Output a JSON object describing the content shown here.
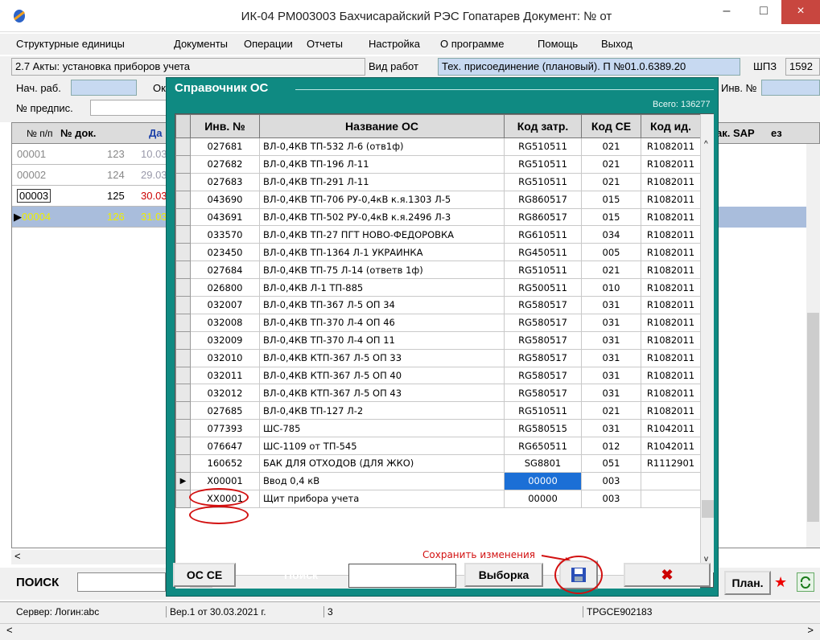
{
  "window": {
    "title": "ИК-04 РМ003003 Бахчисарайский РЭС Гопатарев Документ: № от",
    "minimize": "–",
    "maximize": "□",
    "close": "×"
  },
  "menu": [
    "Структурные единицы",
    "Документы",
    "Операции",
    "Отчеты",
    "Настройка",
    "О программе",
    "Помощь",
    "Выход"
  ],
  "info": {
    "act": "2.7  Акты: установка приборов учета",
    "work_label": "Вид работ",
    "work_value": "Тех. присоединение (плановый). П №01.0.6389.20",
    "shpz_label": "ШПЗ",
    "shpz_value": "1592"
  },
  "filters": {
    "start_label": "Нач. раб.",
    "ok_label": "Ок",
    "inv_label": "Инв. №",
    "prescr_label": "№ предпис."
  },
  "left_grid": {
    "headers": [
      "№ п/п",
      "№ док.",
      "Да"
    ],
    "rows": [
      {
        "n": "00001",
        "doc": "123",
        "date": "10.03"
      },
      {
        "n": "00002",
        "doc": "124",
        "date": "29.03"
      },
      {
        "n": "00003",
        "doc": "125",
        "date": "30.03"
      },
      {
        "n": "00004",
        "doc": "126",
        "date": "31.03"
      }
    ]
  },
  "right_grid": {
    "headers": [
      "ак. SAP",
      "ез"
    ]
  },
  "bottom": {
    "search_label": "ПОИСК",
    "plan_button": "План."
  },
  "status": {
    "server": "Сервер:  Логин:abc",
    "version": "Вер.1 от 30.03.2021 г.",
    "num": "3",
    "code": "TPGCE902183"
  },
  "dialog": {
    "title": "Справочник ОС",
    "total": "Всего: 136277",
    "headers": [
      "Инв. №",
      "Название ОС",
      "Код затр.",
      "Код СЕ",
      "Код ид."
    ],
    "rows": [
      [
        "027681",
        "ВЛ-0,4КВ ТП-532 Л-6 (отв1ф)",
        "RG510511",
        "021",
        "R1082011"
      ],
      [
        "027682",
        "ВЛ-0,4КВ ТП-196 Л-11",
        "RG510511",
        "021",
        "R1082011"
      ],
      [
        "027683",
        "ВЛ-0,4КВ ТП-291 Л-11",
        "RG510511",
        "021",
        "R1082011"
      ],
      [
        "043690",
        "ВЛ-0,4КВ ТП-706 РУ-0,4кВ к.я.1303 Л-5",
        "RG860517",
        "015",
        "R1082011"
      ],
      [
        "043691",
        "ВЛ-0,4КВ ТП-502 РУ-0,4кВ к.я.2496 Л-3",
        "RG860517",
        "015",
        "R1082011"
      ],
      [
        "033570",
        "ВЛ-0,4КВ ТП-27 ПГТ НОВО-ФЕДОРОВКА",
        "RG610511",
        "034",
        "R1082011"
      ],
      [
        "023450",
        "ВЛ-0,4КВ ТП-1364 Л-1 УКРАИНКА",
        "RG450511",
        "005",
        "R1082011"
      ],
      [
        "027684",
        "ВЛ-0,4КВ ТП-75 Л-14 (ответв 1ф)",
        "RG510511",
        "021",
        "R1082011"
      ],
      [
        "026800",
        "ВЛ-0,4КВ Л-1 ТП-885",
        "RG500511",
        "010",
        "R1082011"
      ],
      [
        "032007",
        "ВЛ-0,4КВ ТП-367 Л-5 ОП 34",
        "RG580517",
        "031",
        "R1082011"
      ],
      [
        "032008",
        "ВЛ-0,4КВ ТП-370 Л-4 ОП 46",
        "RG580517",
        "031",
        "R1082011"
      ],
      [
        "032009",
        "ВЛ-0,4КВ ТП-370 Л-4 ОП 11",
        "RG580517",
        "031",
        "R1082011"
      ],
      [
        "032010",
        "ВЛ-0,4КВ КТП-367 Л-5 ОП 33",
        "RG580517",
        "031",
        "R1082011"
      ],
      [
        "032011",
        "ВЛ-0,4КВ КТП-367 Л-5 ОП 40",
        "RG580517",
        "031",
        "R1082011"
      ],
      [
        "032012",
        "ВЛ-0,4КВ КТП-367 Л-5 ОП 43",
        "RG580517",
        "031",
        "R1082011"
      ],
      [
        "027685",
        "ВЛ-0,4КВ ТП-127 Л-2",
        "RG510511",
        "021",
        "R1082011"
      ],
      [
        "077393",
        "ШС-785",
        "RG580515",
        "031",
        "R1042011"
      ],
      [
        "076647",
        "ШС-1109 от ТП-545",
        "RG650511",
        "012",
        "R1042011"
      ],
      [
        "160652",
        "БАК ДЛЯ ОТХОДОВ (ДЛЯ ЖКО)",
        "SG8801",
        "051",
        "R1112901"
      ],
      [
        "X00001",
        "Ввод 0,4 кВ",
        "00000",
        "003",
        ""
      ],
      [
        "XX0001",
        "Щит прибора учета",
        "00000",
        "003",
        ""
      ]
    ],
    "save_hint": "Сохранить изменения",
    "btn_osce": "ОС СЕ",
    "search_label": "Поиск",
    "btn_select": "Выборка",
    "delete_icon": "✖",
    "save_icon": "floppy-disk"
  },
  "colors": {
    "dialog_bg": "#0f8a82",
    "selection": "#1b6fd6",
    "annotation_red": "#d21010"
  }
}
